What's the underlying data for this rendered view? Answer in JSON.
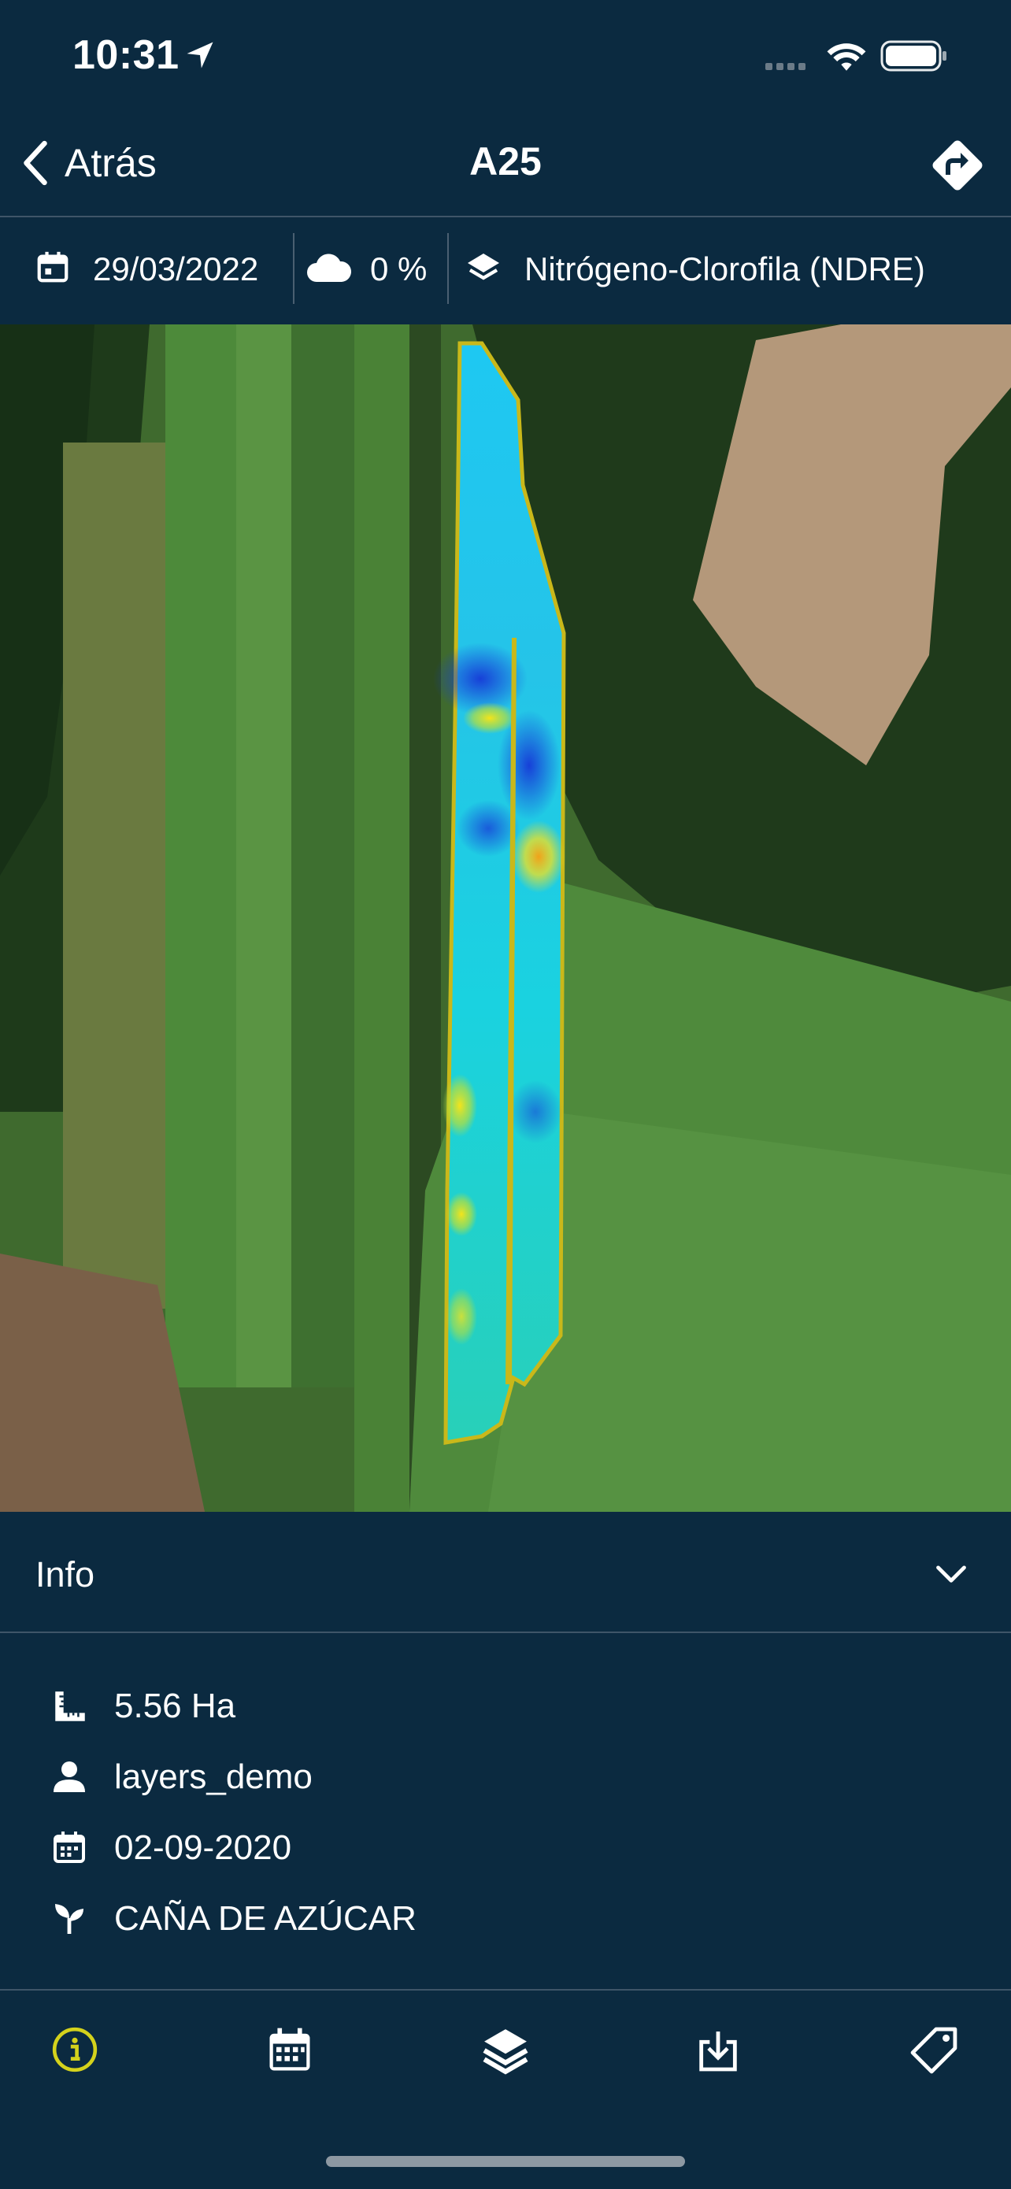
{
  "status_bar": {
    "time": "10:31",
    "icons": [
      "location-arrow-icon",
      "signal-icon",
      "wifi-icon",
      "battery-icon"
    ]
  },
  "nav": {
    "back_label": "Atrás",
    "title": "A25",
    "action_icon": "directions-icon"
  },
  "filters": {
    "date": "29/03/2022",
    "cloud": "0 %",
    "layer": "Nitrógeno-Clorofila (NDRE)",
    "date_icon": "calendar-icon",
    "cloud_icon": "cloud-icon",
    "layer_icon": "layers-icon"
  },
  "info": {
    "header_label": "Info",
    "area": "5.56 Ha",
    "user": "layers_demo",
    "date": "02-09-2020",
    "crop": "CAÑA DE AZÚCAR"
  },
  "tabs": [
    {
      "icon": "info-icon",
      "active": true
    },
    {
      "icon": "calendar-icon",
      "active": false
    },
    {
      "icon": "layers-icon",
      "active": false
    },
    {
      "icon": "download-icon",
      "active": false
    },
    {
      "icon": "tag-icon",
      "active": false
    }
  ],
  "colors": {
    "background": "#0b2a40",
    "accent_active": "#d4d21c",
    "divider": "#3f5568",
    "field_outline": "#c9b81a"
  }
}
